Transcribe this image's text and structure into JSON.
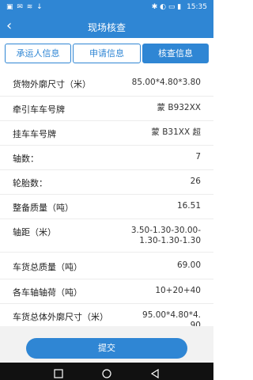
{
  "status_bar": {
    "left_icons": "▣ ✉ ≋ ↓",
    "right_icons": "✱ ◐ ▭ ▮",
    "time": "15:35"
  },
  "nav": {
    "back_icon": "chevron-left",
    "title": "现场核查"
  },
  "tabs": [
    {
      "label": "承运人信息",
      "active": false
    },
    {
      "label": "申请信息",
      "active": false
    },
    {
      "label": "核查信息",
      "active": true
    }
  ],
  "details": [
    {
      "label": "货物外廓尺寸（米）",
      "value": "85.00*4.80*3.80"
    },
    {
      "label": "牵引车车号牌",
      "value": "蒙 B932XX"
    },
    {
      "label": "挂车车号牌",
      "value": "蒙 B31XX 超"
    },
    {
      "label": "轴数：",
      "value": "7"
    },
    {
      "label": "轮胎数：",
      "value": "26"
    },
    {
      "label": "整备质量（吨）",
      "value": "16.51"
    },
    {
      "label": "轴距（米）",
      "value": "3.50-1.30-30.00-1.30-1.30-1.30"
    },
    {
      "label": "车货总质量（吨）",
      "value": "69.00"
    },
    {
      "label": "各车轴轴荷（吨）",
      "value": "10+20+40"
    },
    {
      "label": "车货总体外廓尺寸（米）",
      "value": "95.00*4.80*4.90"
    }
  ],
  "actions": {
    "submit_label": "提交"
  }
}
